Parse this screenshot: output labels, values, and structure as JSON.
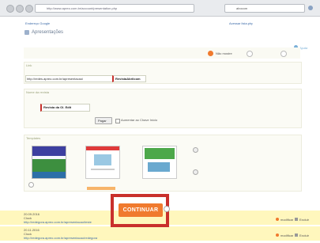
{
  "browser": {
    "url": "http://www.apreo.com.br/account/presentation.php",
    "search_value": "abocom"
  },
  "header": {
    "left_link": "Endereço Google",
    "right_link": "Acessar lista.php",
    "title": "Apresentações",
    "help_label": "Ajuda"
  },
  "options": {
    "radio1_label": "Não mostre",
    "radio2_label": "",
    "radio3_label": ""
  },
  "address": {
    "label": "Link",
    "url_value": "http://redes.apreo.com.br/apresentacao/",
    "suffix_value": "RevistaAbrilcom"
  },
  "name": {
    "label": "Nome da revista",
    "value": "Revista da Ol. Edit",
    "action_label": "Pagar",
    "note": "Aumentar ao Chave Início"
  },
  "templates": {
    "label": "Templates"
  },
  "bottom": {
    "continuar_label": "CONTINUAR",
    "row1_date": "20.09.2016",
    "row1_title": "Clock",
    "row1_url": "http://redegora.apreo.com.br/apresentacao/teste",
    "row1_action1": "modificar",
    "row1_action2": "Excluir",
    "row2_date": "20.11.2016",
    "row2_title": "Clock",
    "row2_url": "http://redegora.apreo.com.br/apresentacao/redegora",
    "row2_action1": "modificar",
    "row2_action2": "Excluir"
  },
  "colors": {
    "accent_orange": "#f07a2e",
    "highlight_red": "#c9302c",
    "yellow_band": "#fff7bd",
    "link_blue": "#3b6aa8"
  }
}
